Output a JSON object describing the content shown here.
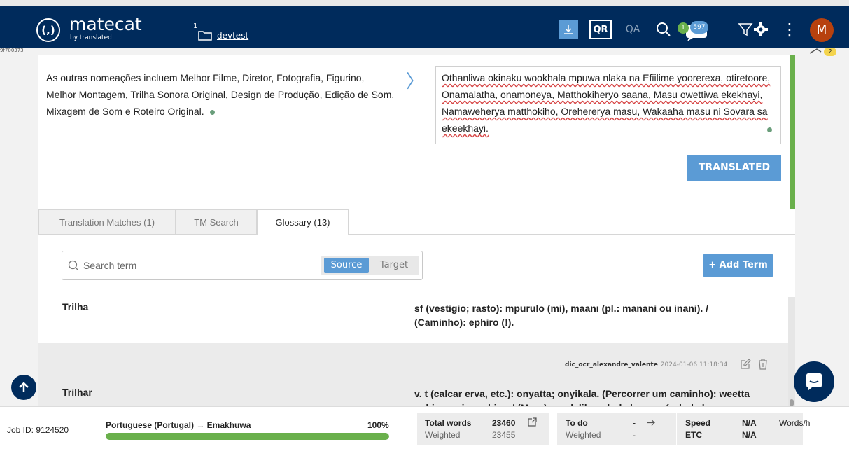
{
  "header": {
    "logo_mark": "(,)",
    "logo_name": "matecat",
    "logo_sub": "by translated",
    "project_number": "1",
    "project_name": "devtest",
    "qr_label": "QR",
    "qa_label": "QA",
    "badge_count_small": "1",
    "badge_count_comments": "597",
    "avatar_initial": "M",
    "kebab": "⋮"
  },
  "left_segment_label": "9f700373",
  "side_comment_count": "2",
  "segment": {
    "source_text": "As outras nomeações incluem Melhor Filme, Diretor, Fotografia, Figurino, Melhor Montagem, Trilha Sonora Original, Design de Produção, Edição de Som, Mixagem de Som e Roteiro Original.",
    "target_text": "Othanliwa okinaku wookhala mpuwa nlaka na Efiilime yoorerexa, otiretoore, Onamalatha, onamoneya, Matthokiheryo saana, Masu owettiwa ekekhayi, Namaweherya matthokiho, Orehererya masu, Wakaaha masu ni Sovara sa ekeekhayi.",
    "status_button": "TRANSLATED"
  },
  "tabs": [
    {
      "label": "Translation Matches (1)"
    },
    {
      "label": "TM Search"
    },
    {
      "label": "Glossary (13)"
    }
  ],
  "glossary": {
    "search_placeholder": "Search term",
    "toggle_source": "Source",
    "toggle_target": "Target",
    "add_term": "+ Add Term",
    "entries": [
      {
        "term": "Trilha",
        "definition": "sf (vestigio; rasto): mpurulo (mi), maanı (pl.: manani ou inani). / (Caminho): ephiro (!)."
      },
      {
        "term": "Trilhar",
        "author": "dic_ocr_alexandre_valente",
        "date": "2024-01-06 11:18:34",
        "definition": "v. t (calcar erva, etc.): onyatta; onyikala. (Percorrer um caminho): weetta ephiro; ovira ephiro. / (Moer): oyulaliha, ohokala um pó ohokala nnewu"
      }
    ]
  },
  "footer": {
    "job_id": "Job ID: 9124520",
    "language_pair": "Portuguese (Portugal) → Emakhuwa",
    "progress_label": "100%",
    "progress_fraction": 1.0,
    "total_words_label": "Total words",
    "total_words_value": "23460",
    "weighted_label": "Weighted",
    "weighted_value": "23455",
    "todo_label": "To do",
    "todo_value": "-",
    "todo_weighted_label": "Weighted",
    "todo_weighted_value": "-",
    "speed_label": "Speed",
    "speed_value": "N/A",
    "speed_unit": "Words/h",
    "etc_label": "ETC",
    "etc_value": "N/A"
  },
  "colors": {
    "header_bg": "#002b5c",
    "accent": "#5b9bd5",
    "success": "#6ab04c",
    "avatar": "#b7410e"
  }
}
